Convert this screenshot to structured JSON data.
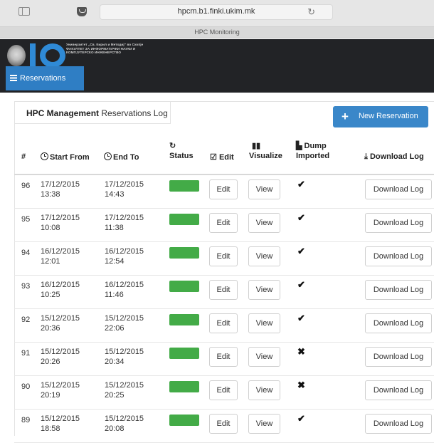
{
  "browser": {
    "url": "hpcm.b1.finki.ukim.mk",
    "tab_title": "HPC Monitoring"
  },
  "header": {
    "faculty_lines": [
      "Универзитет „Св. Кирил и Методиј“ во Скопје",
      "ФАКУЛТЕТ ЗА ИНФОРМАТИЧКИ НАУКИ И",
      "КОМПЈУТЕРСКО ИНЖЕНЕРСТВО"
    ],
    "nav_label": "Reservations"
  },
  "panel": {
    "title_bold": "HPC Management",
    "title_rest": "Reservations Log",
    "new_button": "New Reservation"
  },
  "table": {
    "columns": {
      "id": "#",
      "start": "Start From",
      "end": "End To",
      "status": "Status",
      "edit": "Edit",
      "visualize": "Visualize",
      "dump_line1": "Dump",
      "dump_line2": "Imported",
      "download": "Download Log"
    },
    "rows": [
      {
        "id": "96",
        "start_date": "17/12/2015",
        "start_time": "13:38",
        "end_date": "17/12/2015",
        "end_time": "14:43",
        "edit": "Edit",
        "view": "View",
        "dump": "✔",
        "download": "Download Log"
      },
      {
        "id": "95",
        "start_date": "17/12/2015",
        "start_time": "10:08",
        "end_date": "17/12/2015",
        "end_time": "11:38",
        "edit": "Edit",
        "view": "View",
        "dump": "✔",
        "download": "Download Log"
      },
      {
        "id": "94",
        "start_date": "16/12/2015",
        "start_time": "12:01",
        "end_date": "16/12/2015",
        "end_time": "12:54",
        "edit": "Edit",
        "view": "View",
        "dump": "✔",
        "download": "Download Log"
      },
      {
        "id": "93",
        "start_date": "16/12/2015",
        "start_time": "10:25",
        "end_date": "16/12/2015",
        "end_time": "11:46",
        "edit": "Edit",
        "view": "View",
        "dump": "✔",
        "download": "Download Log"
      },
      {
        "id": "92",
        "start_date": "15/12/2015",
        "start_time": "20:36",
        "end_date": "15/12/2015",
        "end_time": "22:06",
        "edit": "Edit",
        "view": "View",
        "dump": "✔",
        "download": "Download Log"
      },
      {
        "id": "91",
        "start_date": "15/12/2015",
        "start_time": "20:26",
        "end_date": "15/12/2015",
        "end_time": "20:34",
        "edit": "Edit",
        "view": "View",
        "dump": "✖",
        "download": "Download Log"
      },
      {
        "id": "90",
        "start_date": "15/12/2015",
        "start_time": "20:19",
        "end_date": "15/12/2015",
        "end_time": "20:25",
        "edit": "Edit",
        "view": "View",
        "dump": "✖",
        "download": "Download Log"
      },
      {
        "id": "89",
        "start_date": "15/12/2015",
        "start_time": "18:58",
        "end_date": "15/12/2015",
        "end_time": "20:08",
        "edit": "Edit",
        "view": "View",
        "dump": "✔",
        "download": "Download Log"
      }
    ]
  },
  "colors": {
    "status_green": "#43ab47",
    "brand_blue": "#3a87c9",
    "header_dark": "#222326"
  },
  "icons": {
    "start": "clock-icon",
    "end": "clock-icon",
    "status": "refresh-icon",
    "edit": "edit-icon",
    "visualize": "bar-chart-icon",
    "dump": "file-icon",
    "download": "download-icon"
  }
}
